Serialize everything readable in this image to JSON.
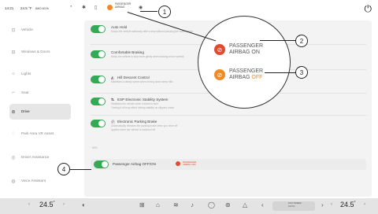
{
  "status_bar": {
    "time": "14:21",
    "outside_temp": "24.5 °F",
    "signal": "IMO  61%",
    "airbag_indicator_text": "PASSENGER AIRBAG",
    "icons": [
      "wifi-icon",
      "bluetooth-icon",
      "phone-icon",
      "eye-icon",
      "power-icon"
    ]
  },
  "sidebar": {
    "items": [
      {
        "icon": "vehicle-icon",
        "label": "Vehicle"
      },
      {
        "icon": "windows-doors-icon",
        "label": "Windows & Doors"
      },
      {
        "icon": "lights-icon",
        "label": "Lights"
      },
      {
        "icon": "seat-icon",
        "label": "Seat"
      },
      {
        "icon": "drive-icon",
        "label": "Drive",
        "active": true
      },
      {
        "icon": "park-assist-icon",
        "label": "Park Area VR Assist"
      },
      {
        "icon": "driver-assistance-icon",
        "label": "Driver Assistance"
      },
      {
        "icon": "voice-assistant-icon",
        "label": "Voice Assistant"
      }
    ]
  },
  "settings": {
    "rows": [
      {
        "title": "Auto Hold",
        "desc": "Keeps the vehicle stationary after a stop without pressing the brake pedal"
      },
      {
        "title": "Comfortable Braking",
        "desc": "Helps the vehicle to stop more gently when braking at low speeds"
      },
      {
        "title": "Hill Descent Control",
        "desc": "Maintains a steady speed when driving down steep hills"
      },
      {
        "title": "ESP Electronic Stability System",
        "desc": "Stabilizes the vehicle when it starts to skid",
        "desc2": "Turning it off may affect driving stability on slippery roads"
      },
      {
        "title": "Electronic Parking Brake",
        "desc": "Automatically releases the parking brake when you drive off",
        "desc2": "Applies when the vehicle is switched off"
      }
    ],
    "section_label": "SRS",
    "airbag_row": {
      "label": "Passenger Airbag OFF/ON",
      "mini_text": "PASSENGER AIRBAG OFF"
    }
  },
  "zoom": {
    "on_line1": "PASSENGER",
    "on_line2": "AIRBAG ON",
    "off_line1": "PASSENGER",
    "off_line2_a": "AIRBAG ",
    "off_line2_b": "OFF",
    "colors": {
      "on": "#e04b2f",
      "off": "#f08a24"
    }
  },
  "callouts": [
    "1",
    "2",
    "3",
    "4"
  ],
  "bottom_bar": {
    "left_temp": "24.5",
    "right_temp": "24.5",
    "degree": "°",
    "fan_text": "FAN SPEED AUTO",
    "icons": [
      "seat-heat-icon",
      "steering-heat-icon",
      "fan-icon",
      "defrost-icon",
      "seat-icon",
      "ac-icon",
      "recirculation-icon",
      "vent-icon"
    ]
  },
  "colors": {
    "toggle_on": "#34a853",
    "accent_orange": "#f08a24",
    "accent_red": "#e04b2f"
  }
}
